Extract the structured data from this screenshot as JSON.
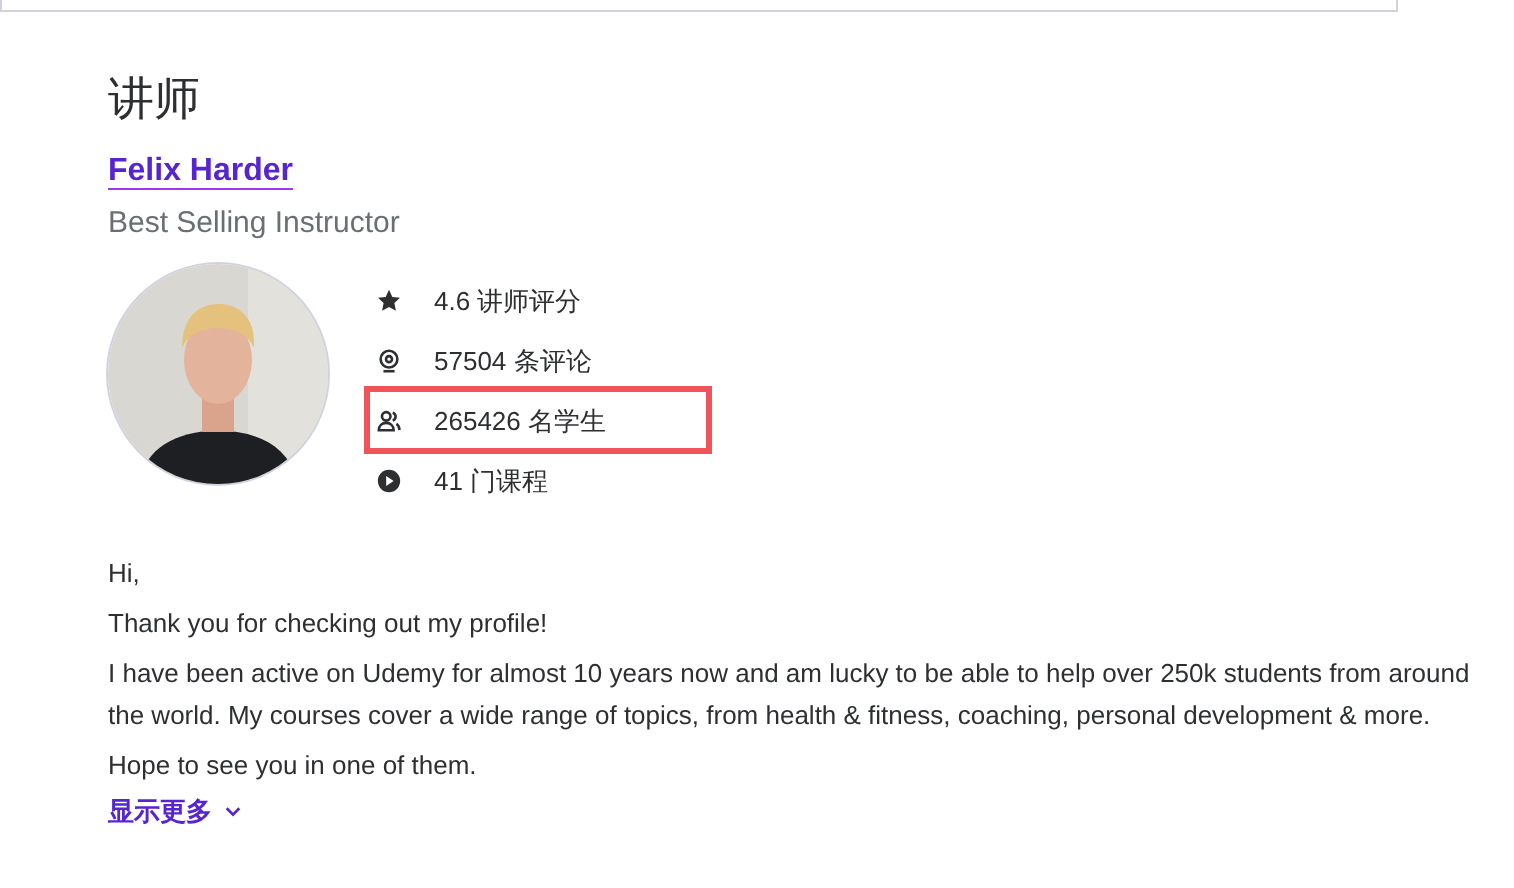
{
  "section_title": "讲师",
  "instructor": {
    "name": "Felix Harder",
    "headline": "Best Selling Instructor"
  },
  "stats": [
    {
      "kind": "rating",
      "text": "4.6 讲师评分",
      "highlighted": false
    },
    {
      "kind": "reviews",
      "text": "57504 条评论",
      "highlighted": false
    },
    {
      "kind": "students",
      "text": "265426 名学生",
      "highlighted": true
    },
    {
      "kind": "courses",
      "text": "41 门课程",
      "highlighted": false
    }
  ],
  "bio": [
    "Hi,",
    "Thank you for checking out my profile!",
    "I have been active on Udemy for almost 10 years now and am lucky to be able to help over 250k students from around the world. My courses cover a wide range of topics, from health & fitness, coaching, personal development & more.",
    "Hope to see you in one of them."
  ],
  "show_more": {
    "label": "显示更多",
    "expanded": false
  }
}
